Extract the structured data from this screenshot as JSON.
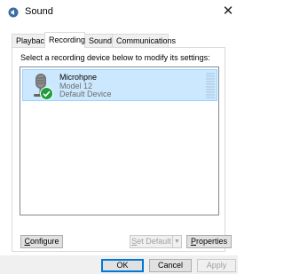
{
  "window": {
    "title": "Sound",
    "icon": "speaker-icon",
    "close_glyph": "✕"
  },
  "tabs": [
    {
      "label": "Playback"
    },
    {
      "label": "Recording",
      "active": true
    },
    {
      "label": "Sounds"
    },
    {
      "label": "Communications"
    }
  ],
  "recording": {
    "instruction": "Select a recording device below to modify its settings:",
    "devices": [
      {
        "name": "Microhpne",
        "model": "Model 12",
        "status": "Default Device",
        "icon": "microphone-icon",
        "status_icon": "checkmark-icon",
        "selected": true
      }
    ]
  },
  "buttons": {
    "configure": {
      "accel": "C",
      "rest": "onfigure"
    },
    "set_default": {
      "accel": "S",
      "rest": "et Default",
      "disabled": true
    },
    "set_default_arrow": "▼",
    "properties": {
      "accel": "P",
      "rest": "roperties"
    },
    "ok": "OK",
    "cancel": "Cancel",
    "apply": {
      "label": "Apply",
      "disabled": true
    }
  },
  "colors": {
    "selection_bg": "#cce8ff",
    "selection_border": "#99d1ff",
    "check_green": "#1e9e3d",
    "focus_blue": "#0078d7"
  }
}
